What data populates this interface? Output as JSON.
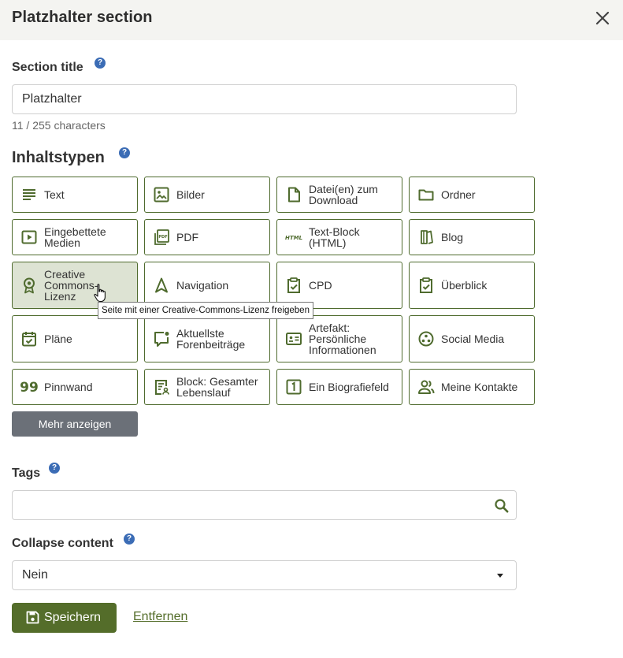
{
  "header": {
    "title": "Platzhalter section"
  },
  "section_title": {
    "label": "Section title",
    "value": "Platzhalter",
    "char_count": "11 / 255 characters"
  },
  "content_types": {
    "heading": "Inhaltstypen",
    "blocks": [
      {
        "label": "Text",
        "icon": "text-lines-icon"
      },
      {
        "label": "Bilder",
        "icon": "image-icon"
      },
      {
        "label": "Datei(en) zum Download",
        "icon": "file-icon"
      },
      {
        "label": "Ordner",
        "icon": "folder-icon"
      },
      {
        "label": "Eingebettete Medien",
        "icon": "play-icon"
      },
      {
        "label": "PDF",
        "icon": "pdf-icon"
      },
      {
        "label": "Text-Block (HTML)",
        "icon": "html-icon"
      },
      {
        "label": "Blog",
        "icon": "book-icon"
      },
      {
        "label": "Creative Commons-Lizenz",
        "icon": "award-icon"
      },
      {
        "label": "Navigation",
        "icon": "navigation-icon"
      },
      {
        "label": "CPD",
        "icon": "clipboard-check-icon"
      },
      {
        "label": "Überblick",
        "icon": "clipboard-check-icon"
      },
      {
        "label": "Pläne",
        "icon": "calendar-check-icon"
      },
      {
        "label": "Aktuellste Forenbeiträge",
        "icon": "message-icon"
      },
      {
        "label": "Artefakt: Persönliche Informationen",
        "icon": "id-card-icon"
      },
      {
        "label": "Social Media",
        "icon": "social-icon"
      },
      {
        "label": "Pinnwand",
        "icon": "quote-icon"
      },
      {
        "label": "Block: Gesamter Lebenslauf",
        "icon": "resume-icon"
      },
      {
        "label": "Ein Biografiefeld",
        "icon": "number-one-icon"
      },
      {
        "label": "Meine Kontakte",
        "icon": "contacts-icon"
      }
    ],
    "more_button": "Mehr anzeigen",
    "tooltip": "Seite mit einer Creative-Commons-Lizenz freigeben"
  },
  "tags": {
    "label": "Tags",
    "value": ""
  },
  "collapse": {
    "label": "Collapse content",
    "value": "Nein"
  },
  "actions": {
    "save": "Speichern",
    "remove": "Entfernen"
  },
  "colors": {
    "accent": "#546d2a",
    "border": "#4f6b2e",
    "help": "#3b6cb5",
    "active_block": "#dde3d3",
    "header_bg": "#f4f4f1"
  }
}
